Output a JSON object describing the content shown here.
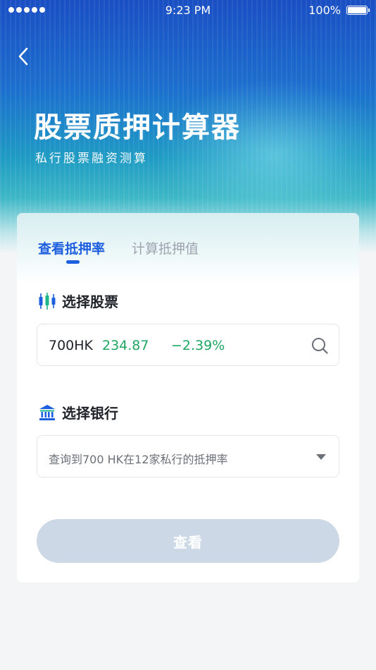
{
  "status_bar": {
    "time": "9:23 PM",
    "battery": "100%"
  },
  "header": {
    "title": "股票质押计算器",
    "subtitle": "私行股票融资测算",
    "back_icon": "chevron-left-icon"
  },
  "tabs": [
    {
      "label": "查看抵押率",
      "active": true
    },
    {
      "label": "计算抵押值",
      "active": false
    }
  ],
  "stock_section": {
    "label": "选择股票",
    "icon": "candlestick-icon",
    "code": "700HK",
    "price": "234.87",
    "change": "−2.39%",
    "search_icon": "search-icon"
  },
  "bank_section": {
    "label": "选择银行",
    "icon": "bank-icon",
    "value": "查询到700 HK在12家私行的抵押率",
    "dropdown_icon": "chevron-down-icon"
  },
  "action": {
    "view_label": "查看"
  },
  "colors": {
    "accent": "#1e5fe0",
    "positive": "#1fa663",
    "button_disabled": "#ccd8e6"
  }
}
